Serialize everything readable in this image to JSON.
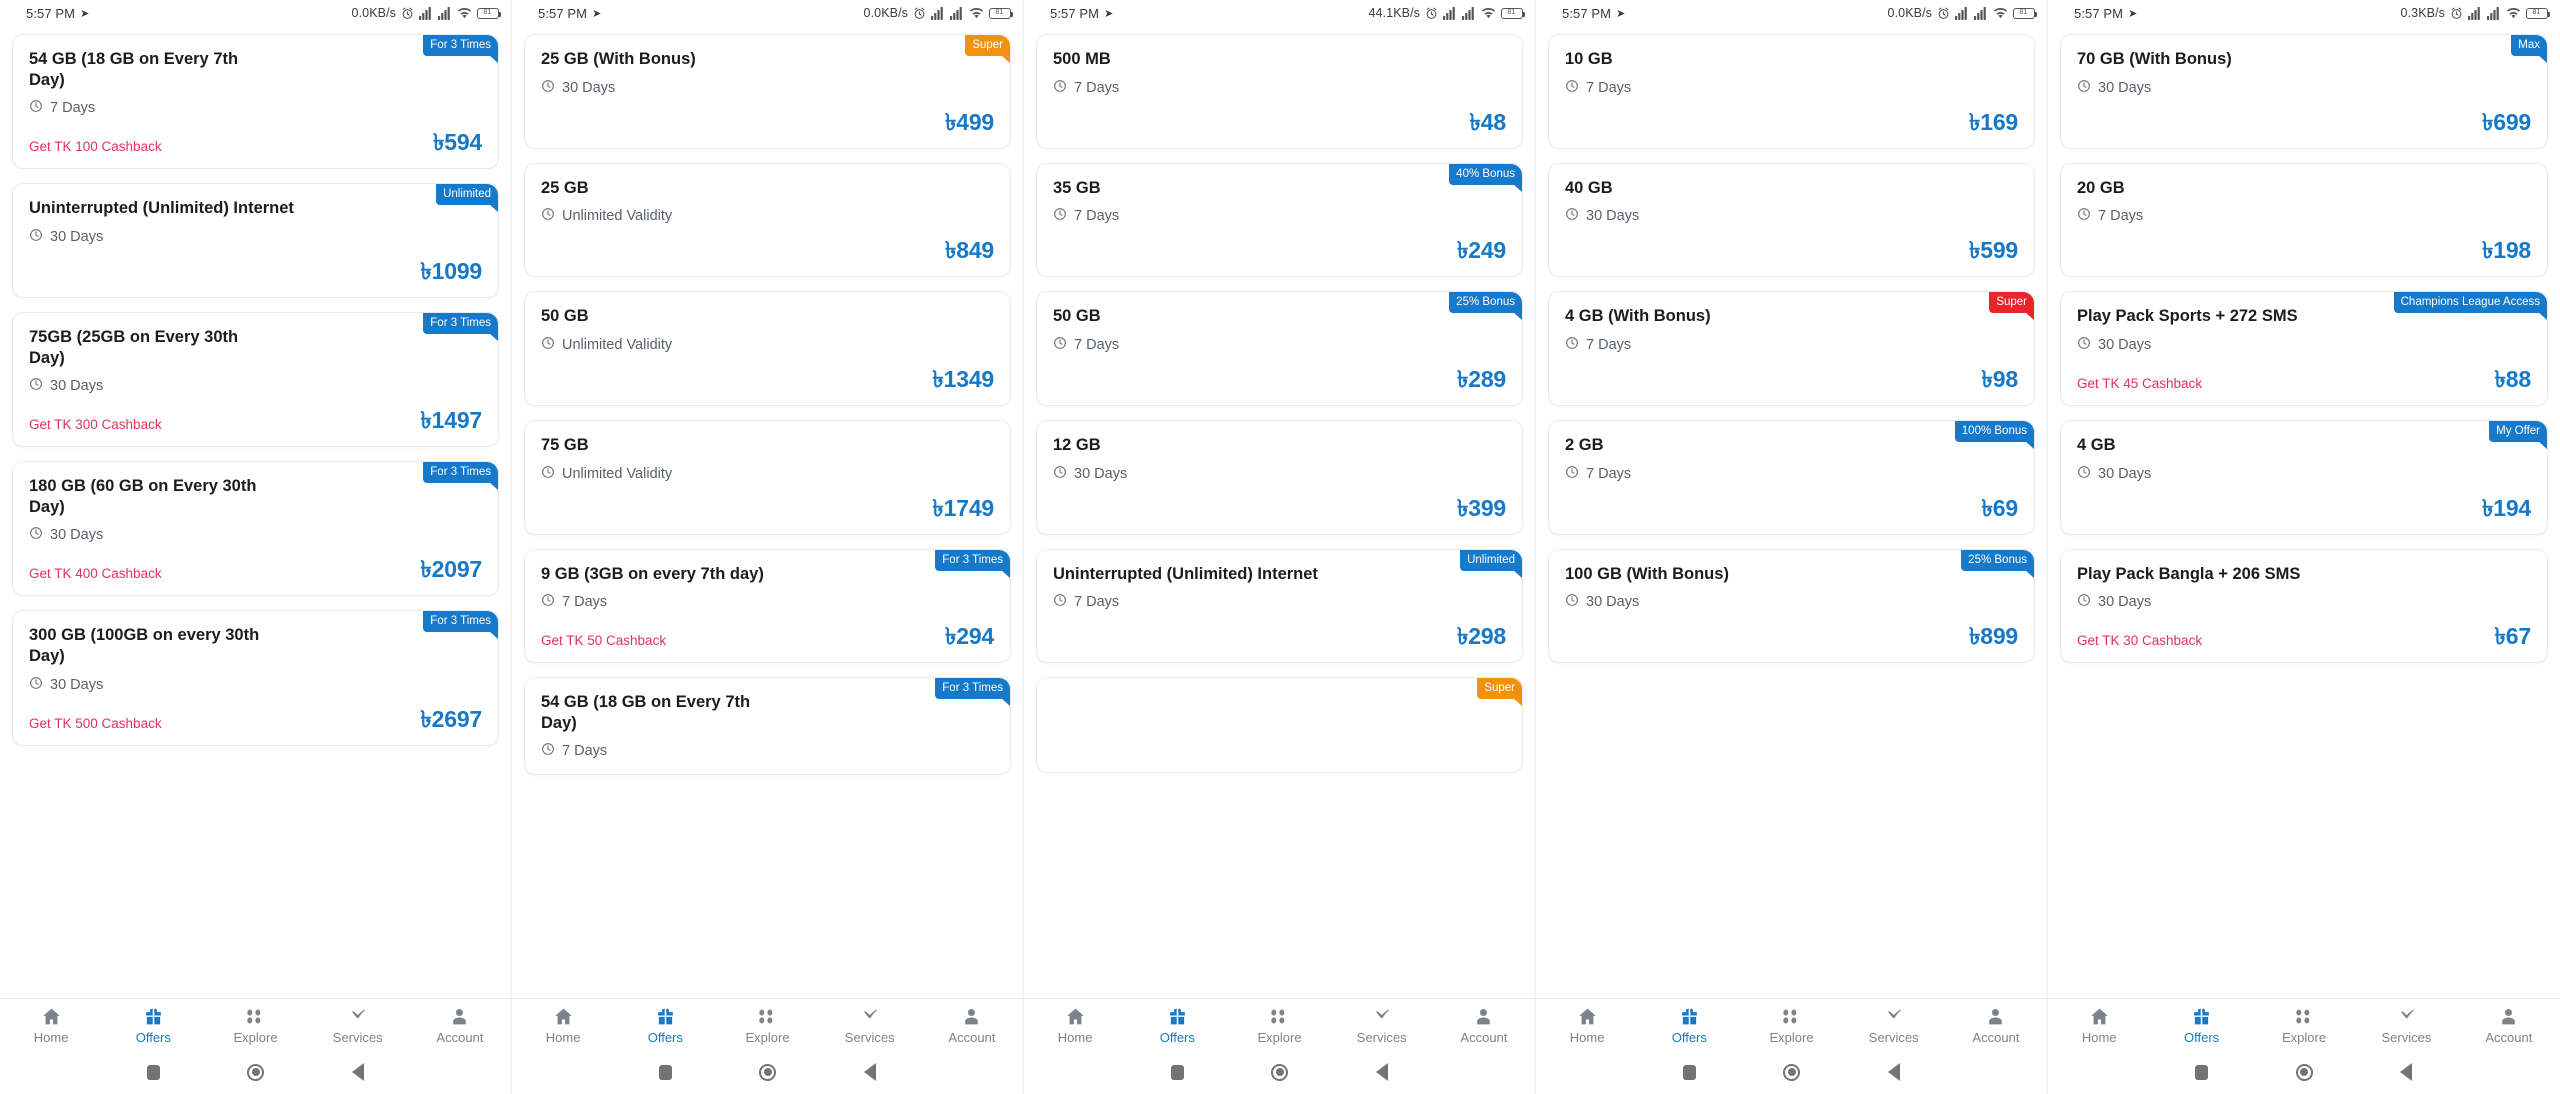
{
  "app": {
    "accent_blue": "#1779ca",
    "cashback_pink": "#e0325c",
    "badge_orange": "#f0920e",
    "badge_red": "#e8252c",
    "currency_symbol": "৳"
  },
  "nav": {
    "items": [
      {
        "label": "Home",
        "icon": "home-icon",
        "active": false
      },
      {
        "label": "Offers",
        "icon": "gift-icon",
        "active": true
      },
      {
        "label": "Explore",
        "icon": "grid-dots-icon",
        "active": false
      },
      {
        "label": "Services",
        "icon": "swoosh-icon",
        "active": false
      },
      {
        "label": "Account",
        "icon": "person-icon",
        "active": false
      }
    ]
  },
  "system_buttons": [
    {
      "name": "recents-button",
      "icon": "square-icon"
    },
    {
      "name": "home-button",
      "icon": "circle-icon"
    },
    {
      "name": "back-button",
      "icon": "triangle-left-icon"
    }
  ],
  "screens": [
    {
      "status": {
        "time": "5:57 PM",
        "net_speed": "0.0KB/s",
        "battery": "81"
      },
      "cards": [
        {
          "title": "54 GB (18 GB on Every 7th Day)",
          "validity": "7 Days",
          "cashback": "Get TK 100 Cashback",
          "price": "৳594",
          "badge": "For 3 Times",
          "badge_color": "blue"
        },
        {
          "title": "Uninterrupted (Unlimited) Internet",
          "validity": "30 Days",
          "cashback": "",
          "price": "৳1099",
          "badge": "Unlimited",
          "badge_color": "blue"
        },
        {
          "title": "75GB (25GB on Every 30th Day)",
          "validity": "30 Days",
          "cashback": "Get TK 300 Cashback",
          "price": "৳1497",
          "badge": "For 3 Times",
          "badge_color": "blue"
        },
        {
          "title": "180 GB (60 GB on Every 30th Day)",
          "validity": "30 Days",
          "cashback": "Get TK 400 Cashback",
          "price": "৳2097",
          "badge": "For 3 Times",
          "badge_color": "blue"
        },
        {
          "title": "300 GB (100GB on every 30th Day)",
          "validity": "30 Days",
          "cashback": "Get TK 500 Cashback",
          "price": "৳2697",
          "badge": "For 3 Times",
          "badge_color": "blue"
        }
      ]
    },
    {
      "status": {
        "time": "5:57 PM",
        "net_speed": "0.0KB/s",
        "battery": "81"
      },
      "cards": [
        {
          "title": "25 GB (With Bonus)",
          "validity": "30 Days",
          "cashback": "",
          "price": "৳499",
          "badge": "Super",
          "badge_color": "orange"
        },
        {
          "title": "25 GB",
          "validity": "Unlimited Validity",
          "cashback": "",
          "price": "৳849",
          "badge": "",
          "badge_color": ""
        },
        {
          "title": "50 GB",
          "validity": "Unlimited Validity",
          "cashback": "",
          "price": "৳1349",
          "badge": "",
          "badge_color": ""
        },
        {
          "title": "75 GB",
          "validity": "Unlimited Validity",
          "cashback": "",
          "price": "৳1749",
          "badge": "",
          "badge_color": ""
        },
        {
          "title": "9 GB (3GB on every 7th day)",
          "validity": "7 Days",
          "cashback": "Get TK 50 Cashback",
          "price": "৳294",
          "badge": "For 3 Times",
          "badge_color": "blue"
        },
        {
          "title": "54 GB (18 GB on Every 7th Day)",
          "validity": "7 Days",
          "cashback": "",
          "price": "",
          "badge": "For 3 Times",
          "badge_color": "blue"
        }
      ]
    },
    {
      "status": {
        "time": "5:57 PM",
        "net_speed": "44.1KB/s",
        "battery": "81"
      },
      "cards": [
        {
          "title": "500 MB",
          "validity": "7 Days",
          "cashback": "",
          "price": "৳48",
          "badge": "",
          "badge_color": ""
        },
        {
          "title": "35 GB",
          "validity": "7 Days",
          "cashback": "",
          "price": "৳249",
          "badge": "40% Bonus",
          "badge_color": "blue"
        },
        {
          "title": "50 GB",
          "validity": "7 Days",
          "cashback": "",
          "price": "৳289",
          "badge": "25% Bonus",
          "badge_color": "blue"
        },
        {
          "title": "12 GB",
          "validity": "30 Days",
          "cashback": "",
          "price": "৳399",
          "badge": "",
          "badge_color": ""
        },
        {
          "title": "Uninterrupted (Unlimited) Internet",
          "validity": "7 Days",
          "cashback": "",
          "price": "৳298",
          "badge": "Unlimited",
          "badge_color": "blue"
        },
        {
          "title": "",
          "validity": "",
          "cashback": "",
          "price": "",
          "badge": "Super",
          "badge_color": "orange"
        }
      ]
    },
    {
      "status": {
        "time": "5:57 PM",
        "net_speed": "0.0KB/s",
        "battery": "81"
      },
      "cards": [
        {
          "title": "10 GB",
          "validity": "7 Days",
          "cashback": "",
          "price": "৳169",
          "badge": "",
          "badge_color": ""
        },
        {
          "title": "40 GB",
          "validity": "30 Days",
          "cashback": "",
          "price": "৳599",
          "badge": "",
          "badge_color": ""
        },
        {
          "title": "4 GB (With Bonus)",
          "validity": "7 Days",
          "cashback": "",
          "price": "৳98",
          "badge": "Super",
          "badge_color": "red"
        },
        {
          "title": "2 GB",
          "validity": "7 Days",
          "cashback": "",
          "price": "৳69",
          "badge": "100% Bonus",
          "badge_color": "blue"
        },
        {
          "title": "100 GB (With Bonus)",
          "validity": "30 Days",
          "cashback": "",
          "price": "৳899",
          "badge": "25% Bonus",
          "badge_color": "blue"
        }
      ]
    },
    {
      "status": {
        "time": "5:57 PM",
        "net_speed": "0.3KB/s",
        "battery": "81"
      },
      "cards": [
        {
          "title": "70 GB (With Bonus)",
          "validity": "30 Days",
          "cashback": "",
          "price": "৳699",
          "badge": "Max",
          "badge_color": "blue"
        },
        {
          "title": "20 GB",
          "validity": "7 Days",
          "cashback": "",
          "price": "৳198",
          "badge": "",
          "badge_color": ""
        },
        {
          "title": "Play Pack Sports  + 272 SMS",
          "validity": "30 Days",
          "cashback": "Get TK 45 Cashback",
          "price": "৳88",
          "badge": "Champions League Access",
          "badge_color": "blue"
        },
        {
          "title": "4 GB",
          "validity": "30 Days",
          "cashback": "",
          "price": "৳194",
          "badge": "My Offer",
          "badge_color": "blue"
        },
        {
          "title": "Play Pack Bangla + 206 SMS",
          "validity": "30 Days",
          "cashback": "Get TK 30 Cashback",
          "price": "৳67",
          "badge": "",
          "badge_color": ""
        }
      ]
    }
  ]
}
